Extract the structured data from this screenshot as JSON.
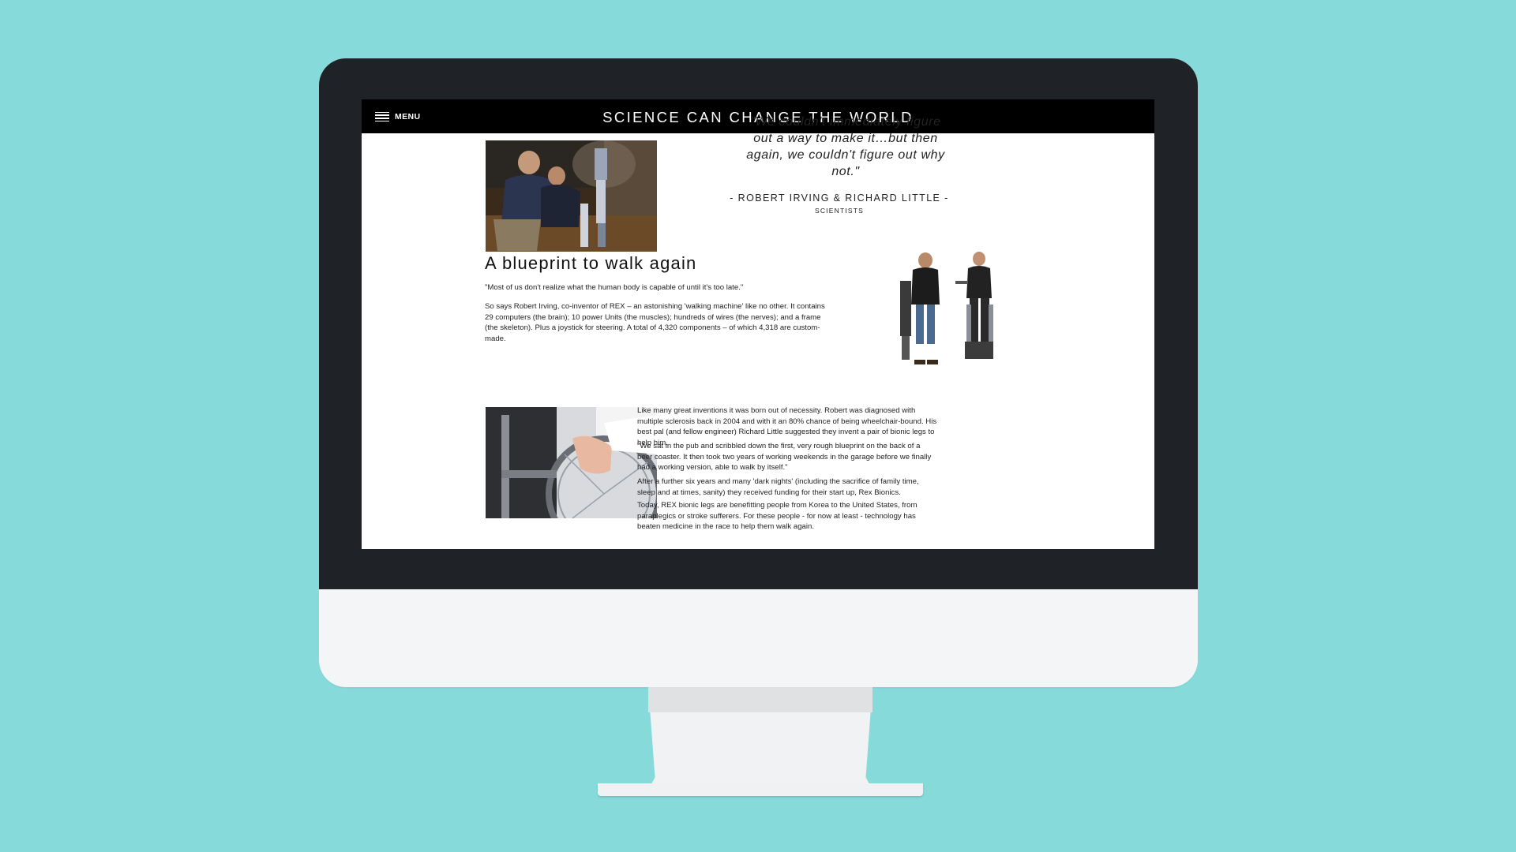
{
  "nav": {
    "menu_label": "MENU",
    "site_title": "SCIENCE CAN CHANGE THE WORLD"
  },
  "quote": {
    "text": "\"We couldn't immediately figure out a way to make it…but then again, we couldn't figure out why not.\"",
    "attribution": "- ROBERT IRVING & RICHARD LITTLE -",
    "role": "SCIENTISTS"
  },
  "article": {
    "heading": "A blueprint to walk again",
    "intro_quote": "\"Most of us don't realize what the human body is capable of until it's too late.\"",
    "intro_paragraph": "So says Robert Irving, co-inventor of REX – an astonishing 'walking machine' like no other. It contains 29 computers (the brain); 10 power Units (the muscles); hundreds of wires (the nerves); and a frame (the skeleton). Plus a joystick for steering. A total of 4,320 components – of which 4,318 are custom-made.",
    "paragraphs": [
      "Like many great inventions it was born out of necessity. Robert was diagnosed with multiple sclerosis back in 2004 and with it an 80% chance of being wheelchair-bound. His best pal (and fellow engineer) Richard Little suggested they invent a pair of bionic legs to help him.",
      "\"We sat in the pub and scribbled down the first, very rough blueprint on the back of a beer coaster. It then took two years of working weekends in the garage before we finally had a working version, able to walk by itself.\"",
      "After a further six years and many 'dark nights' (including the sacrifice of family time, sleep and at times, sanity) they received funding for their start up, Rex Bionics.",
      "Today, REX bionic legs are benefitting people from Korea to the United States, from paraplegics or stroke sufferers. For these people - for now at least - technology has beaten medicine in the race to help them walk again."
    ]
  },
  "colors": {
    "background": "#86dbda",
    "bezel": "#1f2226",
    "chin": "#f4f5f6",
    "navbar": "#000000"
  }
}
